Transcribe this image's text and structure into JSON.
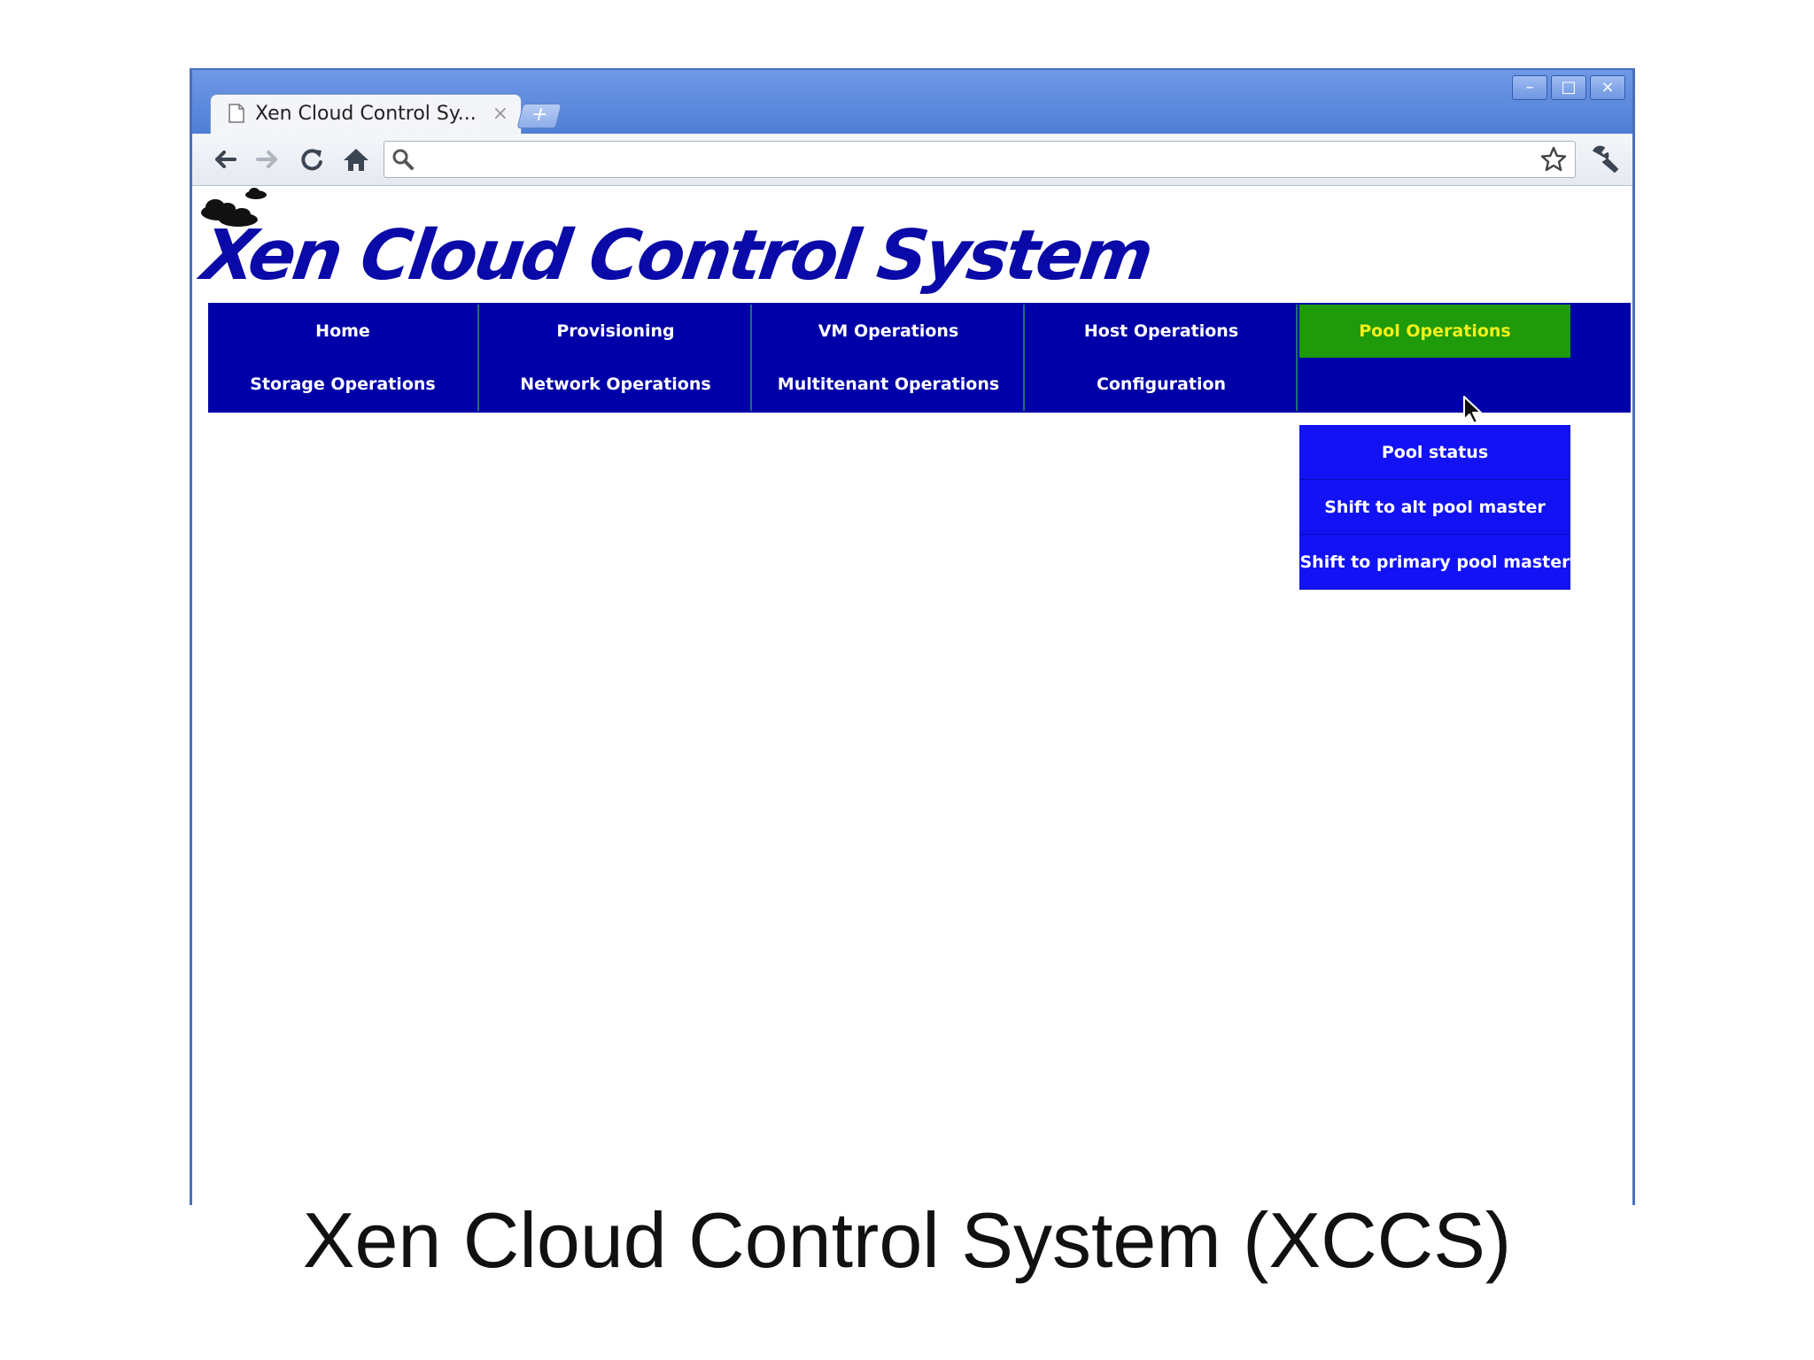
{
  "browser": {
    "tab_title": "Xen Cloud Control Sy...",
    "tab_close": "×",
    "new_tab": "+",
    "window_controls": {
      "minimize": "–",
      "maximize": "□",
      "close": "×"
    },
    "icons": [
      "page-icon",
      "back-icon",
      "forward-icon",
      "reload-icon",
      "home-icon",
      "search-icon",
      "star-icon",
      "wrench-icon"
    ]
  },
  "page": {
    "logo_title": "Xen Cloud Control System",
    "nav_row1": [
      "Home",
      "Provisioning",
      "VM Operations",
      "Host Operations",
      "Pool Operations"
    ],
    "nav_row2": [
      "Storage Operations",
      "Network Operations",
      "Multitenant Operations",
      "Configuration"
    ],
    "dropdown": [
      "Pool status",
      "Shift to alt pool master",
      "Shift to primary pool master"
    ],
    "colors": {
      "nav_bg": "#0000a8",
      "nav_active_bg": "#1e9a0a",
      "nav_active_text": "#f4ef1a",
      "dropdown_bg": "#1212f4",
      "logo_text": "#0a0aa8"
    }
  },
  "caption": "Xen Cloud Control System (XCCS)"
}
